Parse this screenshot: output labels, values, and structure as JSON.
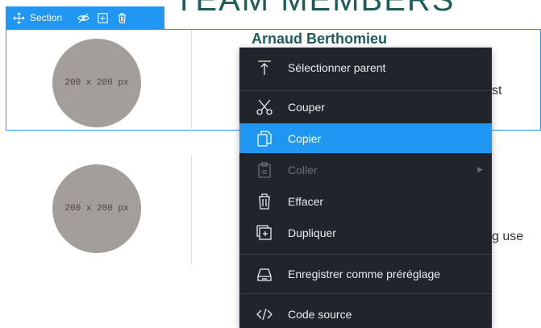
{
  "page": {
    "heading_fragment": "TEAM MEMBERS",
    "member_name": "Arnaud Berthomieu",
    "text_fragment_1": "st",
    "text_fragment_2": "g use"
  },
  "section_toolbar": {
    "label": "Section",
    "icons": [
      "move-icon",
      "eye-off-icon",
      "duplicate-icon",
      "trash-icon"
    ]
  },
  "placeholders": [
    "200 x 200 px",
    "200 x 200 px"
  ],
  "context_menu": {
    "items": [
      {
        "label": "Sélectionner parent",
        "icon": "select-parent-icon"
      },
      {
        "label": "Couper",
        "icon": "scissors-icon"
      },
      {
        "label": "Copier",
        "icon": "copy-icon",
        "state": "active"
      },
      {
        "label": "Coller",
        "icon": "paste-icon",
        "state": "disabled",
        "submenu": true
      },
      {
        "label": "Effacer",
        "icon": "trash-icon"
      },
      {
        "label": "Dupliquer",
        "icon": "duplicate-icon"
      },
      {
        "label": "Enregistrer comme préréglage",
        "icon": "save-preset-icon"
      },
      {
        "label": "Code source",
        "icon": "code-icon"
      }
    ]
  },
  "colors": {
    "accent": "#2196f3",
    "menu_background": "#21252b",
    "menu_active": "#1e97f3",
    "heading": "#1b5e57",
    "placeholder": "#a39e99"
  }
}
